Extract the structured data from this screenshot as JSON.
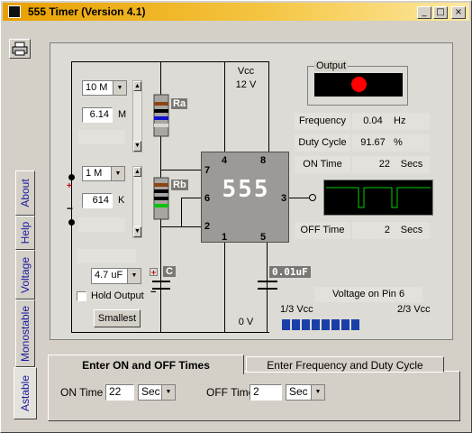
{
  "window": {
    "title": "555 Timer  (Version 4.1)",
    "controls": {
      "minimize": "_",
      "maximize": "□",
      "close": "×"
    }
  },
  "side_tabs": [
    "About",
    "Help",
    "Voltage",
    "Monostable",
    "Astable"
  ],
  "circuit": {
    "vcc_label": "Vcc",
    "vcc_value": "12 V",
    "ground_label": "0 V",
    "chip_label": "555",
    "pins": {
      "p1": "1",
      "p2": "2",
      "p3": "3",
      "p4": "4",
      "p5": "5",
      "p6": "6",
      "p7": "7",
      "p8": "8"
    },
    "ra": {
      "label": "Ra",
      "range": "10 M",
      "value": "6.14",
      "unit": "M"
    },
    "rb": {
      "label": "Rb",
      "range": "1 M",
      "value": "614",
      "unit": "K"
    },
    "capacitor": {
      "label": "C",
      "value": "4.7 uF"
    },
    "control_cap": "0.01uF",
    "hold_output_label": "Hold Output",
    "smallest_button": "Smallest",
    "plus_sign": "+",
    "minus_sign": "−"
  },
  "output": {
    "label": "Output",
    "led_color": "#ff0000"
  },
  "readouts": {
    "frequency": {
      "label": "Frequency",
      "value": "0.04",
      "unit": "Hz"
    },
    "duty_cycle": {
      "label": "Duty Cycle",
      "value": "91.67",
      "unit": "%"
    },
    "on_time": {
      "label": "ON Time",
      "value": "22",
      "unit": "Secs"
    },
    "off_time": {
      "label": "OFF Time",
      "value": "2",
      "unit": "Secs"
    }
  },
  "pin6": {
    "title": "Voltage on Pin 6",
    "left_label": "1/3 Vcc",
    "right_label": "2/3 Vcc",
    "segments_filled": 8,
    "bar_color": "#1a3fa8"
  },
  "bottom_tabs": {
    "active": "Enter ON and OFF Times",
    "inactive": "Enter Frequency and Duty Cycle"
  },
  "times": {
    "on_label": "ON Time",
    "on_value": "22",
    "on_unit": "Sec",
    "off_label": "OFF Time",
    "off_value": "2",
    "off_unit": "Sec"
  },
  "colors": {
    "title_gradient_start": "#e8a000",
    "scope_green": "#00d000"
  }
}
